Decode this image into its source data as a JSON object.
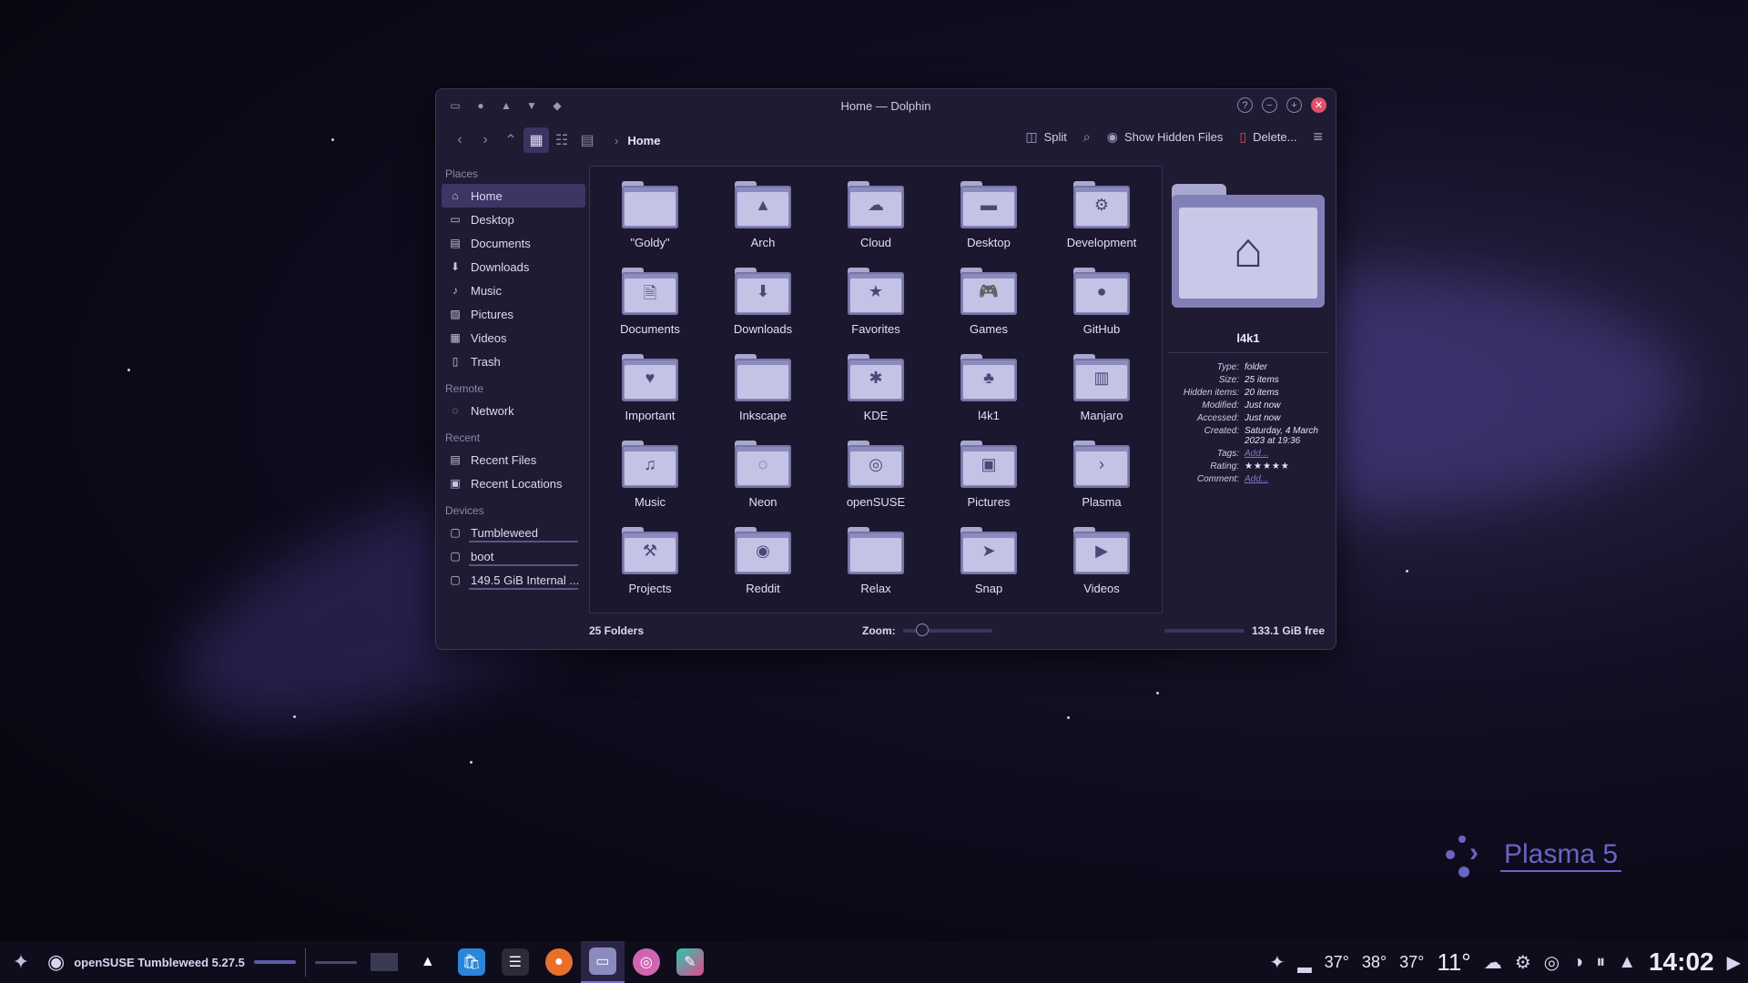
{
  "window": {
    "title": "Home — Dolphin",
    "controls": {
      "help": "?",
      "minimize": "−",
      "maximize": "+",
      "close": "✕"
    }
  },
  "toolbar": {
    "breadcrumb": "Home",
    "split_label": "Split",
    "show_hidden_label": "Show Hidden Files",
    "delete_label": "Delete..."
  },
  "sidebar": {
    "places_header": "Places",
    "places": [
      {
        "label": "Home",
        "icon": "home-icon"
      },
      {
        "label": "Desktop",
        "icon": "desktop-icon"
      },
      {
        "label": "Documents",
        "icon": "documents-icon"
      },
      {
        "label": "Downloads",
        "icon": "downloads-icon"
      },
      {
        "label": "Music",
        "icon": "music-icon"
      },
      {
        "label": "Pictures",
        "icon": "pictures-icon"
      },
      {
        "label": "Videos",
        "icon": "videos-icon"
      },
      {
        "label": "Trash",
        "icon": "trash-icon"
      }
    ],
    "remote_header": "Remote",
    "remote": [
      {
        "label": "Network",
        "icon": "network-icon"
      }
    ],
    "recent_header": "Recent",
    "recent": [
      {
        "label": "Recent Files",
        "icon": "recent-files-icon"
      },
      {
        "label": "Recent Locations",
        "icon": "recent-locations-icon"
      }
    ],
    "devices_header": "Devices",
    "devices": [
      {
        "label": "Tumbleweed",
        "icon": "drive-icon"
      },
      {
        "label": "boot",
        "icon": "drive-icon"
      },
      {
        "label": "149.5 GiB Internal ...",
        "icon": "drive-icon"
      }
    ]
  },
  "folders": [
    {
      "name": "\"Goldy\"",
      "icon": ""
    },
    {
      "name": "Arch",
      "icon": "▲"
    },
    {
      "name": "Cloud",
      "icon": "☁"
    },
    {
      "name": "Desktop",
      "icon": "▬"
    },
    {
      "name": "Development",
      "icon": "⚙"
    },
    {
      "name": "Documents",
      "icon": "🗎"
    },
    {
      "name": "Downloads",
      "icon": "⬇"
    },
    {
      "name": "Favorites",
      "icon": "★"
    },
    {
      "name": "Games",
      "icon": "🎮"
    },
    {
      "name": "GitHub",
      "icon": "●"
    },
    {
      "name": "Important",
      "icon": "♥"
    },
    {
      "name": "Inkscape",
      "icon": ""
    },
    {
      "name": "KDE",
      "icon": "✱"
    },
    {
      "name": "l4k1",
      "icon": "♣"
    },
    {
      "name": "Manjaro",
      "icon": "▥"
    },
    {
      "name": "Music",
      "icon": "♫"
    },
    {
      "name": "Neon",
      "icon": "◌"
    },
    {
      "name": "openSUSE",
      "icon": "◎"
    },
    {
      "name": "Pictures",
      "icon": "▣"
    },
    {
      "name": "Plasma",
      "icon": "›"
    },
    {
      "name": "Projects",
      "icon": "⚒"
    },
    {
      "name": "Reddit",
      "icon": "◉"
    },
    {
      "name": "Relax",
      "icon": ""
    },
    {
      "name": "Snap",
      "icon": "➤"
    },
    {
      "name": "Videos",
      "icon": "▶"
    }
  ],
  "info_panel": {
    "name": "l4k1",
    "rows": [
      {
        "k": "Type:",
        "v": "folder"
      },
      {
        "k": "Size:",
        "v": "25 items"
      },
      {
        "k": "Hidden items:",
        "v": "20 items"
      },
      {
        "k": "Modified:",
        "v": "Just now"
      },
      {
        "k": "Accessed:",
        "v": "Just now"
      },
      {
        "k": "Created:",
        "v": "Saturday, 4 March 2023 at 19:36"
      }
    ],
    "tags_label": "Tags:",
    "tags_value": "Add...",
    "rating_label": "Rating:",
    "rating_value": 0,
    "rating_max": 5,
    "comment_label": "Comment:",
    "comment_value": "Add..."
  },
  "status": {
    "count": "25 Folders",
    "zoom_label": "Zoom:",
    "zoom_level": 0.15,
    "free_space": "133.1 GiB free"
  },
  "desktop": {
    "plasma_text": "Plasma 5"
  },
  "taskbar": {
    "session_label": "openSUSE Tumbleweed 5.27.5",
    "temps": [
      "37°",
      "38°",
      "37°"
    ],
    "weather_temp": "11°",
    "clock": "14:02"
  },
  "colors": {
    "accent": "#6a64c4",
    "window_bg": "#1f1b33",
    "close": "#e0506a"
  }
}
